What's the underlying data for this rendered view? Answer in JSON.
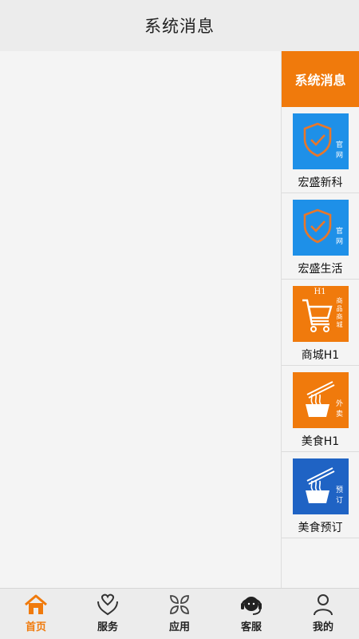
{
  "header": {
    "title": "系统消息"
  },
  "sidebar": {
    "heading": "系统消息",
    "items": [
      {
        "label": "宏盛新科",
        "icon": "shield-check-icon",
        "badge": [
          "官",
          "网"
        ],
        "color": "#1e90e8"
      },
      {
        "label": "宏盛生活",
        "icon": "shield-check-icon",
        "badge": [
          "官",
          "网"
        ],
        "color": "#1e90e8"
      },
      {
        "label": "商城H1",
        "icon": "shopping-cart-icon",
        "badge": [
          "商",
          "品",
          "商",
          "城"
        ],
        "tag": "H1",
        "color": "#f07a0c"
      },
      {
        "label": "美食H1",
        "icon": "noodles-icon",
        "badge": [
          "外",
          "卖"
        ],
        "color": "#f07a0c"
      },
      {
        "label": "美食预订",
        "icon": "noodles-icon",
        "badge": [
          "预",
          "订"
        ],
        "color": "#1f63c4"
      }
    ]
  },
  "tabbar": {
    "items": [
      {
        "label": "首页",
        "icon": "home-icon",
        "active": true
      },
      {
        "label": "服务",
        "icon": "heart-hands-icon",
        "active": false
      },
      {
        "label": "应用",
        "icon": "apps-grid-icon",
        "active": false
      },
      {
        "label": "客服",
        "icon": "headset-icon",
        "active": false
      },
      {
        "label": "我的",
        "icon": "person-icon",
        "active": false
      }
    ]
  },
  "colors": {
    "accent": "#f07a0c",
    "blue": "#1e90e8",
    "dark_blue": "#1f63c4"
  }
}
